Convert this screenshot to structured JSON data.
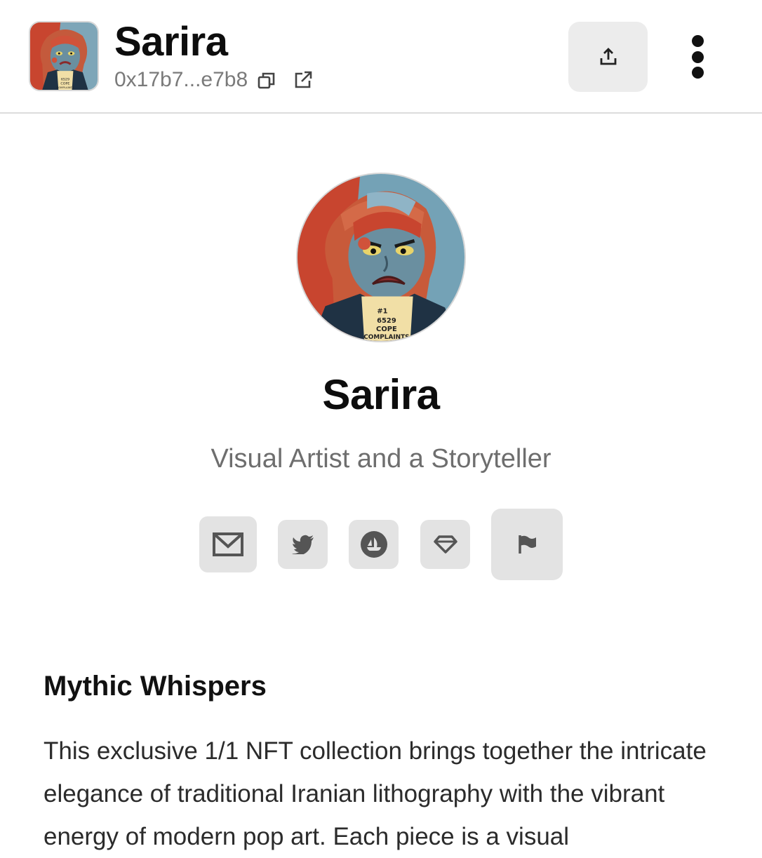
{
  "header": {
    "title": "Sarira",
    "address": "0x17b7...e7b8",
    "icons": {
      "copy": "copy-icon",
      "external": "external-link-icon",
      "share": "share-upload-icon",
      "more": "more-vertical-icon"
    }
  },
  "profile": {
    "name": "Sarira",
    "tagline": "Visual Artist and a Storyteller",
    "avatar_shirt_text": [
      "#1",
      "6529",
      "COPE",
      "COMPLAINTS"
    ]
  },
  "social_links": [
    {
      "name": "email",
      "icon": "mail-icon"
    },
    {
      "name": "twitter",
      "icon": "twitter-icon"
    },
    {
      "name": "opensea",
      "icon": "opensea-icon"
    },
    {
      "name": "gem",
      "icon": "diamond-icon"
    },
    {
      "name": "report",
      "icon": "flag-icon"
    }
  ],
  "collection": {
    "title": "Mythic Whispers",
    "description": "This exclusive 1/1 NFT collection brings together the intricate elegance of traditional Iranian lithography with the vibrant energy of modern pop art. Each piece is a visual"
  },
  "colors": {
    "avatar_red": "#c8452f",
    "avatar_blue": "#6f9bb0",
    "skin_blue": "#6a8fa0",
    "button_bg": "#e3e3e3",
    "icon_gray": "#555555"
  }
}
